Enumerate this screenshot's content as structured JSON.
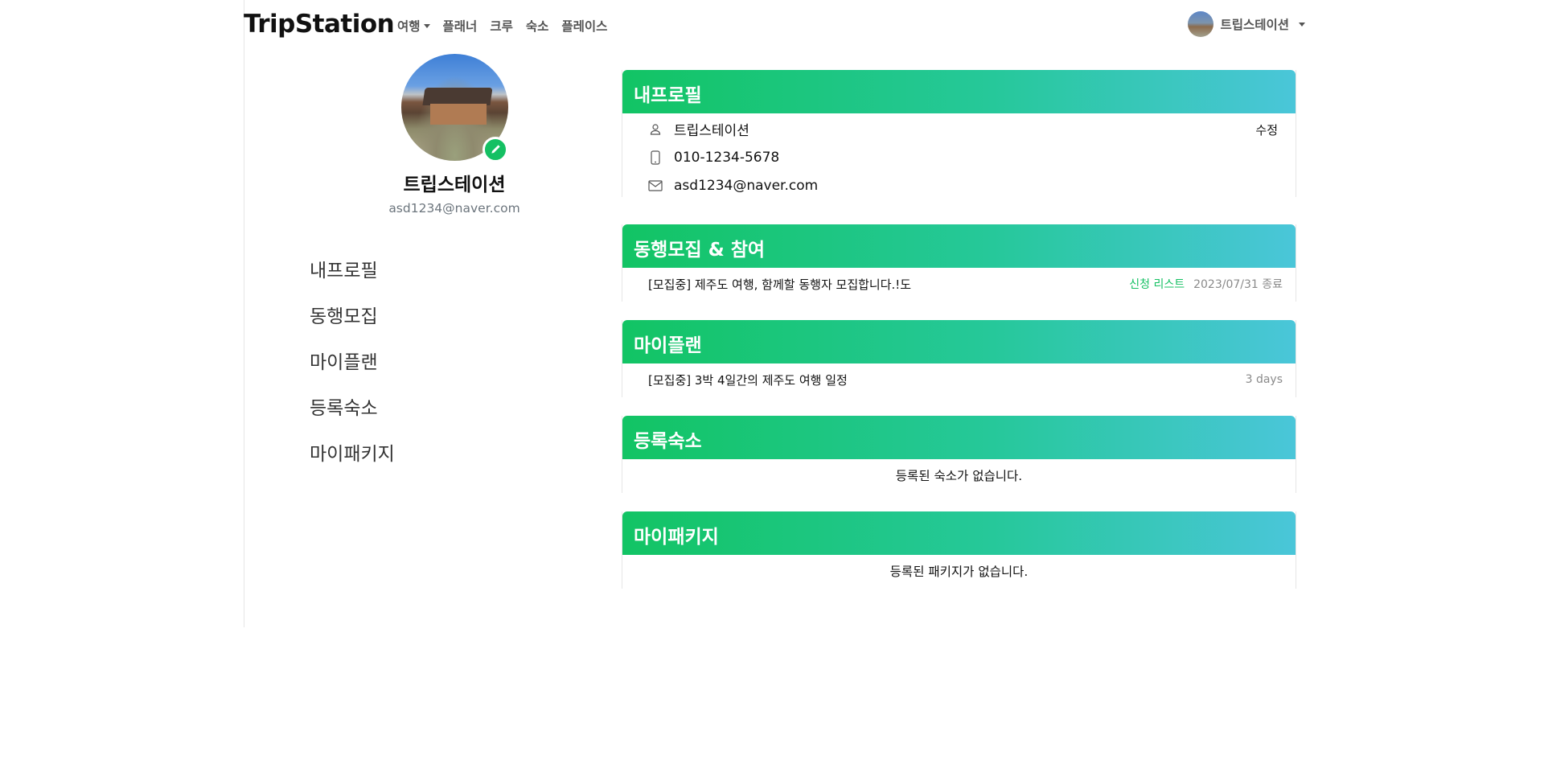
{
  "brand": "TripStation",
  "nav": {
    "items": [
      {
        "label": "여행",
        "dropdown": true
      },
      {
        "label": "플래너",
        "dropdown": false
      },
      {
        "label": "크루",
        "dropdown": false
      },
      {
        "label": "숙소",
        "dropdown": false
      },
      {
        "label": "플레이스",
        "dropdown": false
      }
    ],
    "user_label": "트립스테이션"
  },
  "profile": {
    "name": "트립스테이션",
    "email": "asd1234@naver.com"
  },
  "sidebar": {
    "items": [
      "내프로필",
      "동행모집",
      "마이플랜",
      "등록숙소",
      "마이패키지"
    ]
  },
  "sections": {
    "my_profile": {
      "title": "내프로필",
      "edit_label": "수정",
      "nickname": "트립스테이션",
      "phone": "010-1234-5678",
      "email": "asd1234@naver.com"
    },
    "crew": {
      "title": "동행모집 & 참여",
      "row": {
        "title": "[모집중] 제주도 여행, 함께할 동행자 모집합니다.!도",
        "applicants_link": "신청 리스트",
        "meta": "2023/07/31 종료"
      }
    },
    "my_plan": {
      "title": "마이플랜",
      "row": {
        "title": "[모집중] 3박 4일간의 제주도 여행 일정",
        "meta": "3 days"
      }
    },
    "lodging": {
      "title": "등록숙소",
      "empty": "등록된 숙소가 없습니다."
    },
    "package": {
      "title": "마이패키지",
      "empty": "등록된 패키지가 없습니다."
    }
  },
  "colors": {
    "accent_green": "#15c063",
    "header_gradient_start": "#12c464",
    "header_gradient_end": "#4ac6d9"
  },
  "icons": {
    "profile_edit": "pencil-icon",
    "nickname": "person-icon",
    "phone": "phone-icon",
    "email": "envelope-icon"
  }
}
